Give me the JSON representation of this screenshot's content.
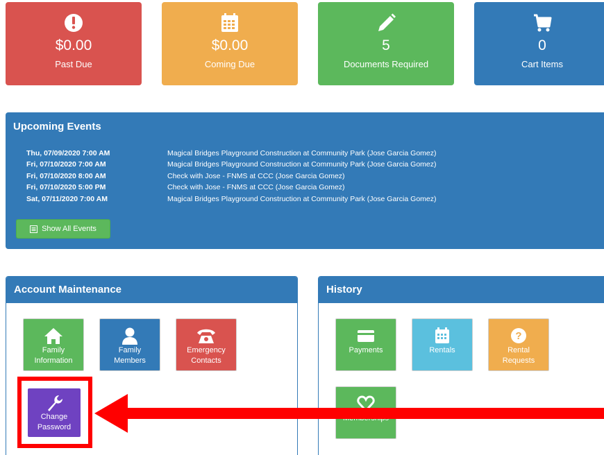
{
  "summary": [
    {
      "amount": "$0.00",
      "label": "Past Due",
      "icon": "exclamation-circle-icon"
    },
    {
      "amount": "$0.00",
      "label": "Coming Due",
      "icon": "calendar-icon"
    },
    {
      "amount": "5",
      "label": "Documents Required",
      "icon": "pencil-icon"
    },
    {
      "amount": "0",
      "label": "Cart Items",
      "icon": "cart-icon"
    }
  ],
  "events": {
    "title": "Upcoming Events",
    "rows": [
      {
        "date": "Thu, 07/09/2020 7:00 AM",
        "text": "Magical Bridges Playground Construction at Community Park (Jose Garcia Gomez)"
      },
      {
        "date": "Fri, 07/10/2020 7:00 AM",
        "text": "Magical Bridges Playground Construction at Community Park (Jose Garcia Gomez)"
      },
      {
        "date": "Fri, 07/10/2020 8:00 AM",
        "text": "Check with Jose - FNMS at CCC (Jose Garcia Gomez)"
      },
      {
        "date": "Fri, 07/10/2020 5:00 PM",
        "text": "Check with Jose - FNMS at CCC (Jose Garcia Gomez)"
      },
      {
        "date": "Sat, 07/11/2020 7:00 AM",
        "text": "Magical Bridges Playground Construction at Community Park (Jose Garcia Gomez)"
      }
    ],
    "show_all_label": "Show All Events"
  },
  "account": {
    "title": "Account Maintenance",
    "buttons": [
      {
        "line1": "Family",
        "line2": "Information",
        "icon": "home-icon"
      },
      {
        "line1": "Family",
        "line2": "Members",
        "icon": "user-icon"
      },
      {
        "line1": "Emergency",
        "line2": "Contacts",
        "icon": "phone-icon"
      },
      {
        "line1": "Change",
        "line2": "Password",
        "icon": "wrench-icon"
      }
    ]
  },
  "history": {
    "title": "History",
    "buttons": [
      {
        "line1": "Payments",
        "line2": "",
        "icon": "credit-card-icon"
      },
      {
        "line1": "Rentals",
        "line2": "",
        "icon": "calendar-icon"
      },
      {
        "line1": "Rental",
        "line2": "Requests",
        "icon": "question-circle-icon"
      },
      {
        "line1": "Memberships",
        "line2": "",
        "icon": "heart-icon"
      }
    ]
  },
  "colors": {
    "red": "#d9534f",
    "orange": "#f0ad4e",
    "green": "#5cb85c",
    "blue": "#337ab7",
    "teal": "#5bc0de",
    "purple": "#6f42c1",
    "annotation": "#ff0000"
  }
}
